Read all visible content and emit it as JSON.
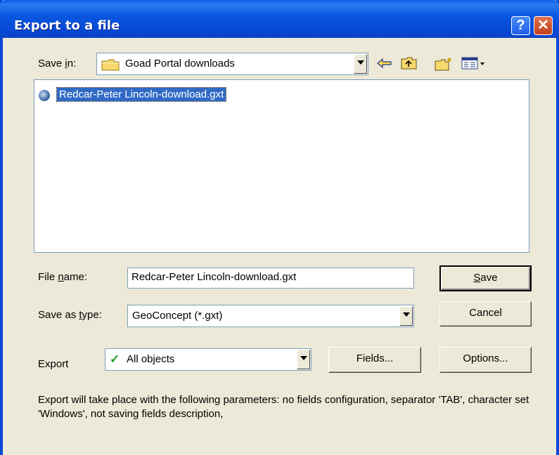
{
  "window": {
    "title": "Export to a file"
  },
  "titlebar": {
    "help_glyph": "?",
    "close_glyph": "✕"
  },
  "save_in": {
    "label_pre": "Save ",
    "label_key": "i",
    "label_post": "n:",
    "value": "Goad Portal downloads",
    "icon": "folder-icon"
  },
  "toolbar": {
    "back_glyph": "⇦",
    "icons": [
      "back-icon",
      "up-folder-icon",
      "new-folder-icon",
      "view-menu-icon"
    ]
  },
  "files": [
    {
      "name": "Redcar-Peter Lincoln-download.gxt",
      "icon": "globe-file-icon"
    }
  ],
  "file_name": {
    "label_pre": "File ",
    "label_key": "n",
    "label_post": "ame:",
    "value": "Redcar-Peter Lincoln-download.gxt"
  },
  "save_type": {
    "label_pre": "Save as ",
    "label_key": "t",
    "label_post": "ype:",
    "value": "GeoConcept (*.gxt)"
  },
  "export": {
    "label": "Export",
    "check_glyph": "✓",
    "value": "All objects"
  },
  "buttons": {
    "save_key": "S",
    "save_rest": "ave",
    "cancel": "Cancel",
    "fields": "Fields...",
    "options": "Options..."
  },
  "description": "Export will take place with the following parameters: no fields configuration, separator 'TAB', character set 'Windows', not saving fields description,",
  "colors": {
    "title_bar": "#0a58e0",
    "selection": "#316ac5",
    "dialog_bg": "#ece9d8"
  }
}
